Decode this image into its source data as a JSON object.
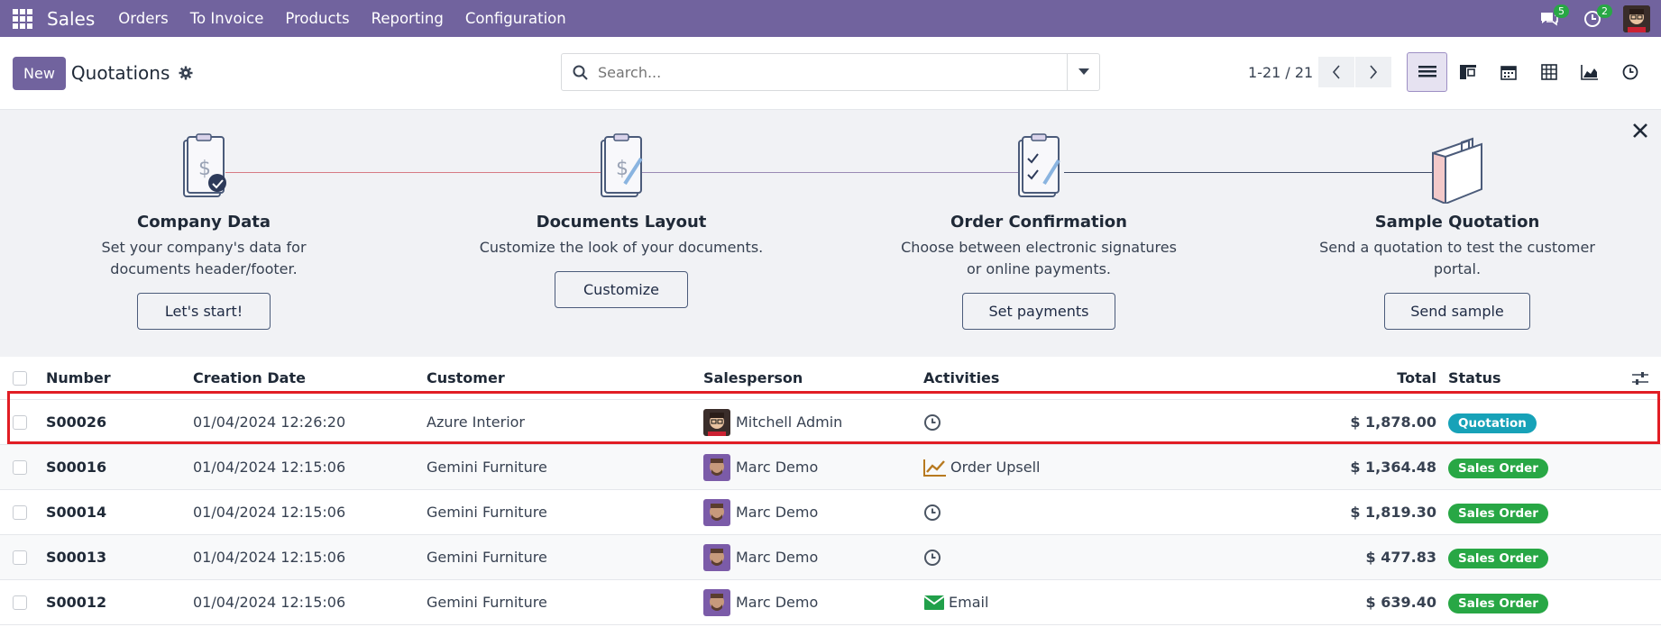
{
  "navbar": {
    "app_name": "Sales",
    "menu": [
      "Orders",
      "To Invoice",
      "Products",
      "Reporting",
      "Configuration"
    ],
    "messages_count": "5",
    "activities_count": "2"
  },
  "control": {
    "new_label": "New",
    "title": "Quotations",
    "search_placeholder": "Search...",
    "pager": "1-21 / 21"
  },
  "onboarding": {
    "steps": [
      {
        "title": "Company Data",
        "desc": "Set your company's data for documents header/footer.",
        "button": "Let's start!"
      },
      {
        "title": "Documents Layout",
        "desc": "Customize the look of your documents.",
        "button": "Customize"
      },
      {
        "title": "Order Confirmation",
        "desc": "Choose between electronic signatures or online payments.",
        "button": "Set payments"
      },
      {
        "title": "Sample Quotation",
        "desc": "Send a quotation to test the customer portal.",
        "button": "Send sample"
      }
    ]
  },
  "table": {
    "headers": {
      "number": "Number",
      "date": "Creation Date",
      "customer": "Customer",
      "salesperson": "Salesperson",
      "activities": "Activities",
      "total": "Total",
      "status": "Status"
    },
    "rows": [
      {
        "number": "S00026",
        "date": "01/04/2024 12:26:20",
        "customer": "Azure Interior",
        "salesperson": "Mitchell Admin",
        "activity": "",
        "activity_icon": "clock-icon",
        "total": "$ 1,878.00",
        "status": "Quotation"
      },
      {
        "number": "S00016",
        "date": "01/04/2024 12:15:06",
        "customer": "Gemini Furniture",
        "salesperson": "Marc Demo",
        "activity": "Order Upsell",
        "activity_icon": "chart-icon",
        "total": "$ 1,364.48",
        "status": "Sales Order"
      },
      {
        "number": "S00014",
        "date": "01/04/2024 12:15:06",
        "customer": "Gemini Furniture",
        "salesperson": "Marc Demo",
        "activity": "",
        "activity_icon": "clock-icon",
        "total": "$ 1,819.30",
        "status": "Sales Order"
      },
      {
        "number": "S00013",
        "date": "01/04/2024 12:15:06",
        "customer": "Gemini Furniture",
        "salesperson": "Marc Demo",
        "activity": "",
        "activity_icon": "clock-icon",
        "total": "$ 477.83",
        "status": "Sales Order"
      },
      {
        "number": "S00012",
        "date": "01/04/2024 12:15:06",
        "customer": "Gemini Furniture",
        "salesperson": "Marc Demo",
        "activity": "Email",
        "activity_icon": "email-icon",
        "total": "$ 639.40",
        "status": "Sales Order"
      }
    ]
  },
  "colors": {
    "brand": "#71639e",
    "quotation": "#17a2b8",
    "sales_order": "#28a745",
    "highlight": "#e11d24"
  }
}
